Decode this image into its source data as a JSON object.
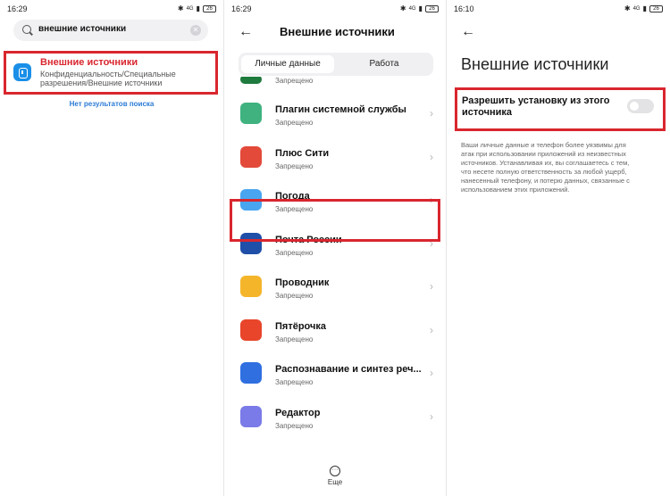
{
  "panel1": {
    "status": {
      "time": "16:29",
      "battery": "26"
    },
    "search": {
      "query": "внешние источники",
      "clear_icon": "close-circle-icon"
    },
    "result": {
      "title": "Внешние источники",
      "subtitle": "Конфиденциальность/Специальные разрешения/Внешние источники",
      "icon": "shield-lock-icon",
      "accent": "#d9262e"
    },
    "no_results": "Нет результатов поиска"
  },
  "panel2": {
    "status": {
      "time": "16:29",
      "battery": "26"
    },
    "title": "Внешние источники",
    "tabs": [
      {
        "label": "Личные данные",
        "active": true
      },
      {
        "label": "Работа",
        "active": false
      }
    ],
    "partial_row": {
      "status": "Запрещено",
      "color": "#1e7a3d"
    },
    "apps": [
      {
        "name": "Плагин системной службы",
        "status": "Запрещено",
        "color": "#3fb27f"
      },
      {
        "name": "Плюс Сити",
        "status": "Запрещено",
        "color": "#e34a3a"
      },
      {
        "name": "Погода",
        "status": "Запрещено",
        "color": "#4aa5f0"
      },
      {
        "name": "Почта России",
        "status": "Запрещено",
        "color": "#1f4fa8"
      },
      {
        "name": "Проводник",
        "status": "Запрещено",
        "color": "#f5b52a"
      },
      {
        "name": "Пятёрочка",
        "status": "Запрещено",
        "color": "#e8452b"
      },
      {
        "name": "Распознавание и синтез реч...",
        "status": "Запрещено",
        "color": "#2f6fe0"
      },
      {
        "name": "Редактор",
        "status": "Запрещено",
        "color": "#7a7ae8"
      }
    ],
    "more_label": "Еще",
    "highlight_color": "#d9262e"
  },
  "panel3": {
    "status": {
      "time": "16:10",
      "battery": "26"
    },
    "title": "Внешние источники",
    "permission_label": "Разрешить установку из этого источника",
    "toggle_on": false,
    "warning": "Ваши личные данные и телефон более уязвимы для атак при использовании приложений из неизвестных источников. Устанавливая их, вы соглашаетесь с тем, что несете полную ответственность за любой ущерб, нанесенный телефону, и потерю данных, связанные с использованием этих приложений."
  }
}
